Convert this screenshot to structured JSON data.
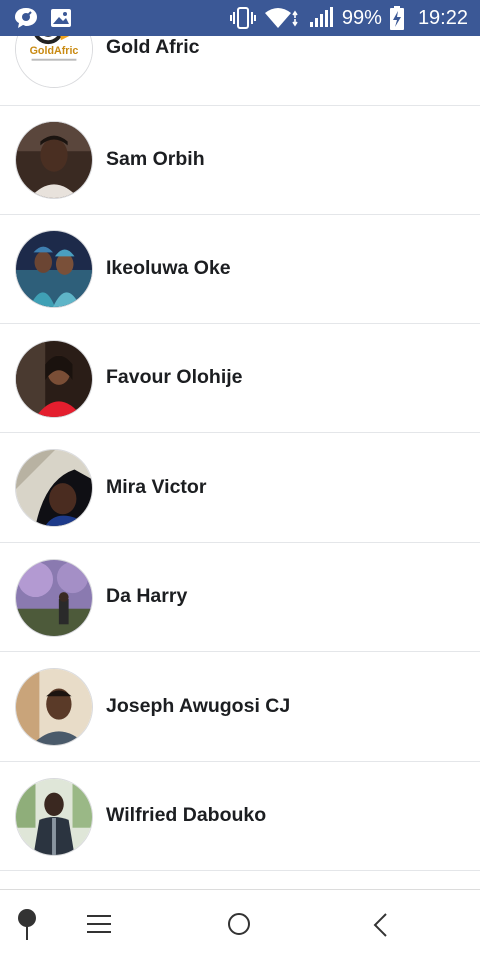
{
  "status_bar": {
    "battery_percent": "99%",
    "time": "19:22",
    "icons": [
      "chat-bubble-icon",
      "image-icon",
      "vibrate-icon",
      "wifi-icon",
      "signal-icon",
      "battery-charging-icon"
    ]
  },
  "contacts": [
    {
      "name": "Gold Afric",
      "avatar_logo_text": "GoldAfric"
    },
    {
      "name": "Sam Orbih"
    },
    {
      "name": "Ikeoluwa Oke"
    },
    {
      "name": "Favour Olohije"
    },
    {
      "name": "Mira Victor"
    },
    {
      "name": "Da Harry"
    },
    {
      "name": "Joseph Awugosi CJ"
    },
    {
      "name": "Wilfried Dabouko"
    }
  ],
  "nav_bar": {
    "icons": [
      "pin-icon",
      "menu-icon",
      "home-circle-icon",
      "back-chevron-icon"
    ]
  },
  "colors": {
    "status_bar_bg": "#3b5896",
    "name_text": "#1c1e21",
    "divider": "#e4e6e9"
  }
}
